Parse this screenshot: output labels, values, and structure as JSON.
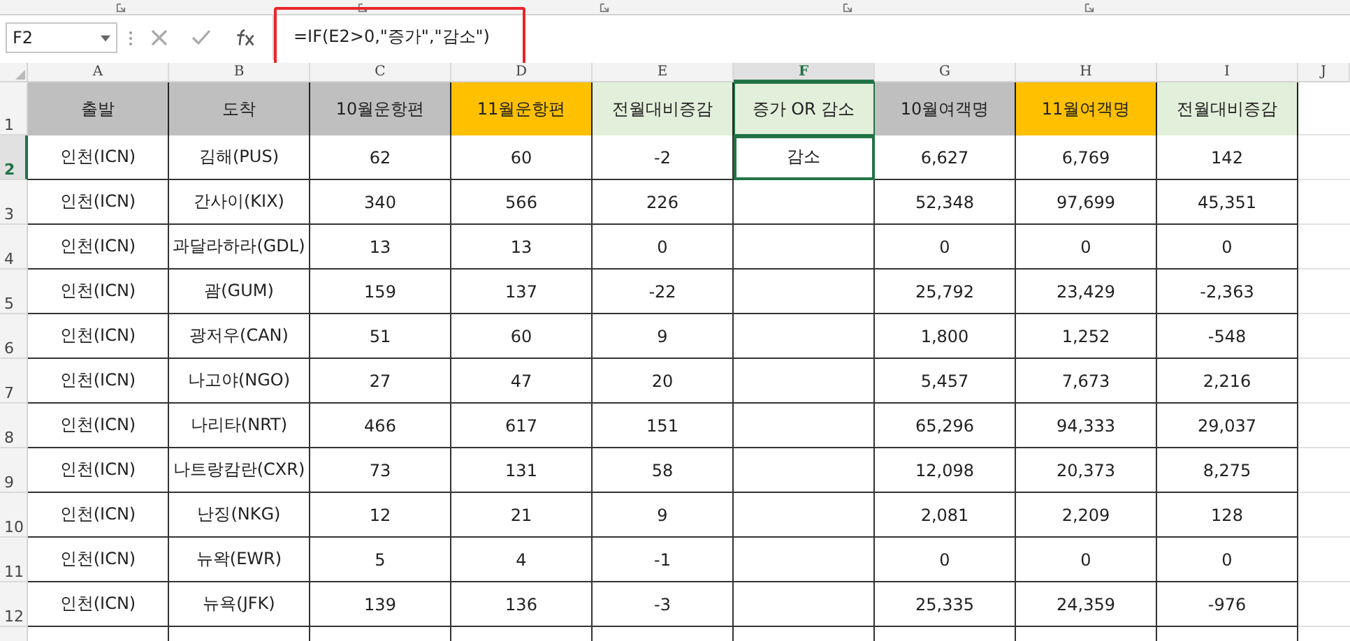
{
  "formula_bar": {
    "name_box": "F2",
    "formula": "=IF(E2>0,\"증가\",\"감소\")",
    "highlighted": true
  },
  "columns": [
    {
      "letter": "A",
      "selected": false
    },
    {
      "letter": "B",
      "selected": false
    },
    {
      "letter": "C",
      "selected": false
    },
    {
      "letter": "D",
      "selected": false
    },
    {
      "letter": "E",
      "selected": false
    },
    {
      "letter": "F",
      "selected": true
    },
    {
      "letter": "G",
      "selected": false
    },
    {
      "letter": "H",
      "selected": false
    },
    {
      "letter": "I",
      "selected": false
    },
    {
      "letter": "J",
      "selected": false
    }
  ],
  "header_row": {
    "number": "1",
    "cells": [
      {
        "text": "출발",
        "color": "#bfbfbf"
      },
      {
        "text": "도착",
        "color": "#bfbfbf"
      },
      {
        "text": "10월운항편",
        "color": "#bfbfbf"
      },
      {
        "text": "11월운항편",
        "color": "#ffc000"
      },
      {
        "text": "전월대비증감",
        "color": "#e2efda"
      },
      {
        "text": "증가 OR 감소",
        "color": "#e2efda"
      },
      {
        "text": "10월여객명",
        "color": "#bfbfbf"
      },
      {
        "text": "11월여객명",
        "color": "#ffc000"
      },
      {
        "text": "전월대비증감",
        "color": "#e2efda"
      }
    ]
  },
  "rows": [
    {
      "number": "2",
      "selected": true,
      "cells": [
        "인천(ICN)",
        "김해(PUS)",
        "62",
        "60",
        "-2",
        "감소",
        "6,627",
        "6,769",
        "142"
      ]
    },
    {
      "number": "3",
      "selected": false,
      "cells": [
        "인천(ICN)",
        "간사이(KIX)",
        "340",
        "566",
        "226",
        null,
        "52,348",
        "97,699",
        "45,351"
      ]
    },
    {
      "number": "4",
      "selected": false,
      "cells": [
        "인천(ICN)",
        "과달라하라(GDL)",
        "13",
        "13",
        "0",
        null,
        "0",
        "0",
        "0"
      ]
    },
    {
      "number": "5",
      "selected": false,
      "cells": [
        "인천(ICN)",
        "괌(GUM)",
        "159",
        "137",
        "-22",
        null,
        "25,792",
        "23,429",
        "-2,363"
      ]
    },
    {
      "number": "6",
      "selected": false,
      "cells": [
        "인천(ICN)",
        "광저우(CAN)",
        "51",
        "60",
        "9",
        null,
        "1,800",
        "1,252",
        "-548"
      ]
    },
    {
      "number": "7",
      "selected": false,
      "cells": [
        "인천(ICN)",
        "나고야(NGO)",
        "27",
        "47",
        "20",
        null,
        "5,457",
        "7,673",
        "2,216"
      ]
    },
    {
      "number": "8",
      "selected": false,
      "cells": [
        "인천(ICN)",
        "나리타(NRT)",
        "466",
        "617",
        "151",
        null,
        "65,296",
        "94,333",
        "29,037"
      ]
    },
    {
      "number": "9",
      "selected": false,
      "cells": [
        "인천(ICN)",
        "나트랑캄란(CXR)",
        "73",
        "131",
        "58",
        null,
        "12,098",
        "20,373",
        "8,275"
      ]
    },
    {
      "number": "10",
      "selected": false,
      "cells": [
        "인천(ICN)",
        "난징(NKG)",
        "12",
        "21",
        "9",
        null,
        "2,081",
        "2,209",
        "128"
      ]
    },
    {
      "number": "11",
      "selected": false,
      "cells": [
        "인천(ICN)",
        "뉴왁(EWR)",
        "5",
        "4",
        "-1",
        null,
        "0",
        "0",
        "0"
      ]
    },
    {
      "number": "12",
      "selected": false,
      "cells": [
        "인천(ICN)",
        "뉴욕(JFK)",
        "139",
        "136",
        "-3",
        null,
        "25,335",
        "24,359",
        "-976"
      ]
    }
  ]
}
